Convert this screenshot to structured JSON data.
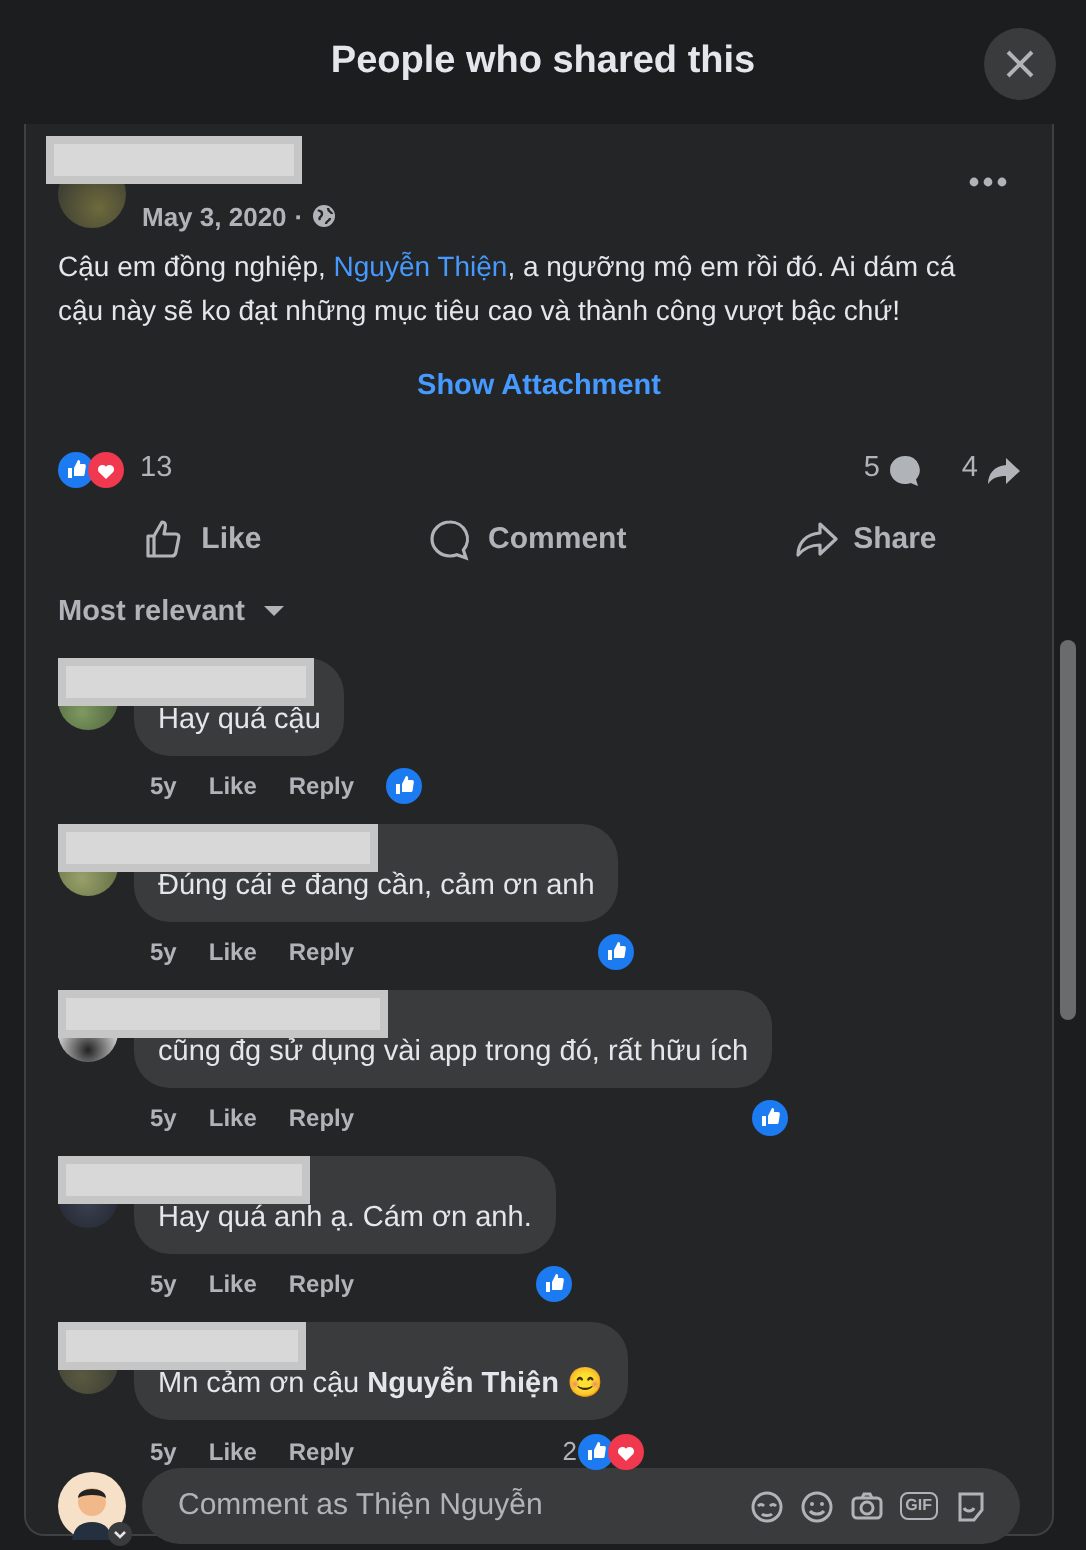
{
  "dialog": {
    "title": "People who shared this"
  },
  "post": {
    "date": "May 3, 2020",
    "audience_separator": "·",
    "text_before": "Cậu em đồng nghiệp, ",
    "mention": "Nguyễn Thiện",
    "text_after": ", a ngưỡng mộ em rồi đó. Ai dám cá cậu này sẽ ko đạt những mục tiêu cao và thành công vượt bậc chứ!",
    "attachment_link": "Show Attachment",
    "reaction_count": "13",
    "reactions": [
      {
        "kind": "like"
      },
      {
        "kind": "heart"
      }
    ],
    "comment_count": "5",
    "share_count": "4"
  },
  "actions": [
    {
      "kind": "like",
      "label": "Like"
    },
    {
      "kind": "comment",
      "label": "Comment"
    },
    {
      "kind": "share",
      "label": "Share"
    }
  ],
  "sort": {
    "label": "Most relevant"
  },
  "comments": [
    {
      "text": "Hay quá cậu",
      "time": "5y",
      "like": "Like",
      "reply": "Reply",
      "reactions": [
        {
          "kind": "like"
        }
      ]
    },
    {
      "text": "Đúng cái e đang cần, cảm ơn anh",
      "time": "5y",
      "like": "Like",
      "reply": "Reply",
      "reactions": [
        {
          "kind": "like"
        }
      ]
    },
    {
      "text": "cũng đg sử dụng vài app trong đó, rất hữu ích",
      "time": "5y",
      "like": "Like",
      "reply": "Reply",
      "reactions": [
        {
          "kind": "like"
        }
      ]
    },
    {
      "text": "Hay quá anh ạ. Cám ơn anh.",
      "time": "5y",
      "like": "Like",
      "reply": "Reply",
      "reactions": [
        {
          "kind": "like"
        }
      ]
    },
    {
      "text": "Mn cảm ơn cậu **Nguyễn Thiện** 😊",
      "time": "5y",
      "like": "Like",
      "reply": "Reply",
      "reaction_count": "2",
      "reactions": [
        {
          "kind": "like"
        },
        {
          "kind": "heart"
        }
      ]
    }
  ],
  "composer": {
    "placeholder": "Comment as Thiện Nguyễn",
    "gif_label": "GIF"
  }
}
